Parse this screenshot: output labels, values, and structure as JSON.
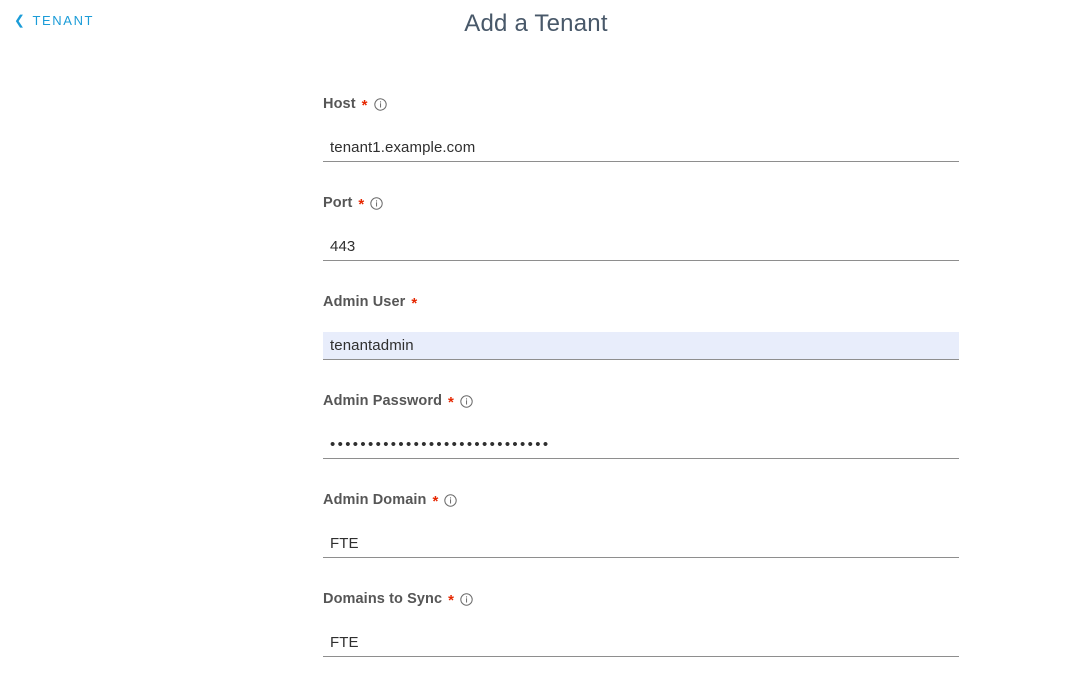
{
  "header": {
    "back_link": {
      "icon": "chevron-left-icon",
      "label": "TENANT"
    },
    "title": "Add a Tenant"
  },
  "form": {
    "fields": [
      {
        "id": "host",
        "label": "Host",
        "required_marker": "*",
        "has_info_icon": true,
        "value": "tenant1.example.com",
        "placeholder": "",
        "type": "text",
        "autofilled": false
      },
      {
        "id": "port",
        "label": "Port",
        "required_marker": "*",
        "has_info_icon": true,
        "value": "443",
        "placeholder": "",
        "type": "text",
        "autofilled": false
      },
      {
        "id": "admin-user",
        "label": "Admin User",
        "required_marker": "*",
        "has_info_icon": false,
        "value": "tenantadmin",
        "placeholder": "",
        "type": "text",
        "autofilled": true
      },
      {
        "id": "admin-password",
        "label": "Admin Password",
        "required_marker": "*",
        "has_info_icon": true,
        "value": "•••••••••••••••••••••••••••••",
        "placeholder": "",
        "type": "password",
        "autofilled": false
      },
      {
        "id": "admin-domain",
        "label": "Admin Domain",
        "required_marker": "*",
        "has_info_icon": true,
        "value": "FTE",
        "placeholder": "",
        "type": "text",
        "autofilled": false
      },
      {
        "id": "domains-to-sync",
        "label": "Domains to Sync",
        "required_marker": "*",
        "has_info_icon": true,
        "value": "FTE",
        "placeholder": "",
        "type": "text",
        "autofilled": false
      }
    ]
  },
  "colors": {
    "link": "#1b9cd8",
    "title": "#485869",
    "label": "#565656",
    "required": "#e62700",
    "underline": "#8e8e8e",
    "autofill_bg": "#e8edfb",
    "value_text": "#2f2f2f",
    "background": "#ffffff"
  }
}
